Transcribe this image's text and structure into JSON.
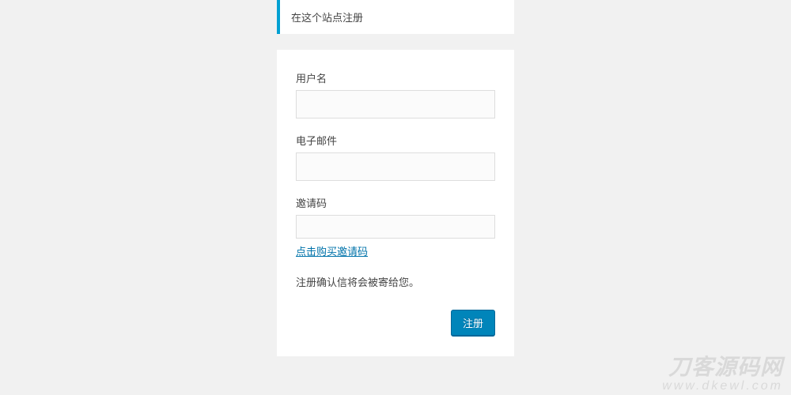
{
  "notice": {
    "text": "在这个站点注册"
  },
  "form": {
    "username_label": "用户名",
    "email_label": "电子邮件",
    "invite_label": "邀请码",
    "buy_invite_link": "点击购买邀请码",
    "confirm_text": "注册确认信将会被寄给您。",
    "submit_label": "注册"
  },
  "watermark": {
    "line1": "刀客源码网",
    "line2": "www.dkewl.com"
  }
}
